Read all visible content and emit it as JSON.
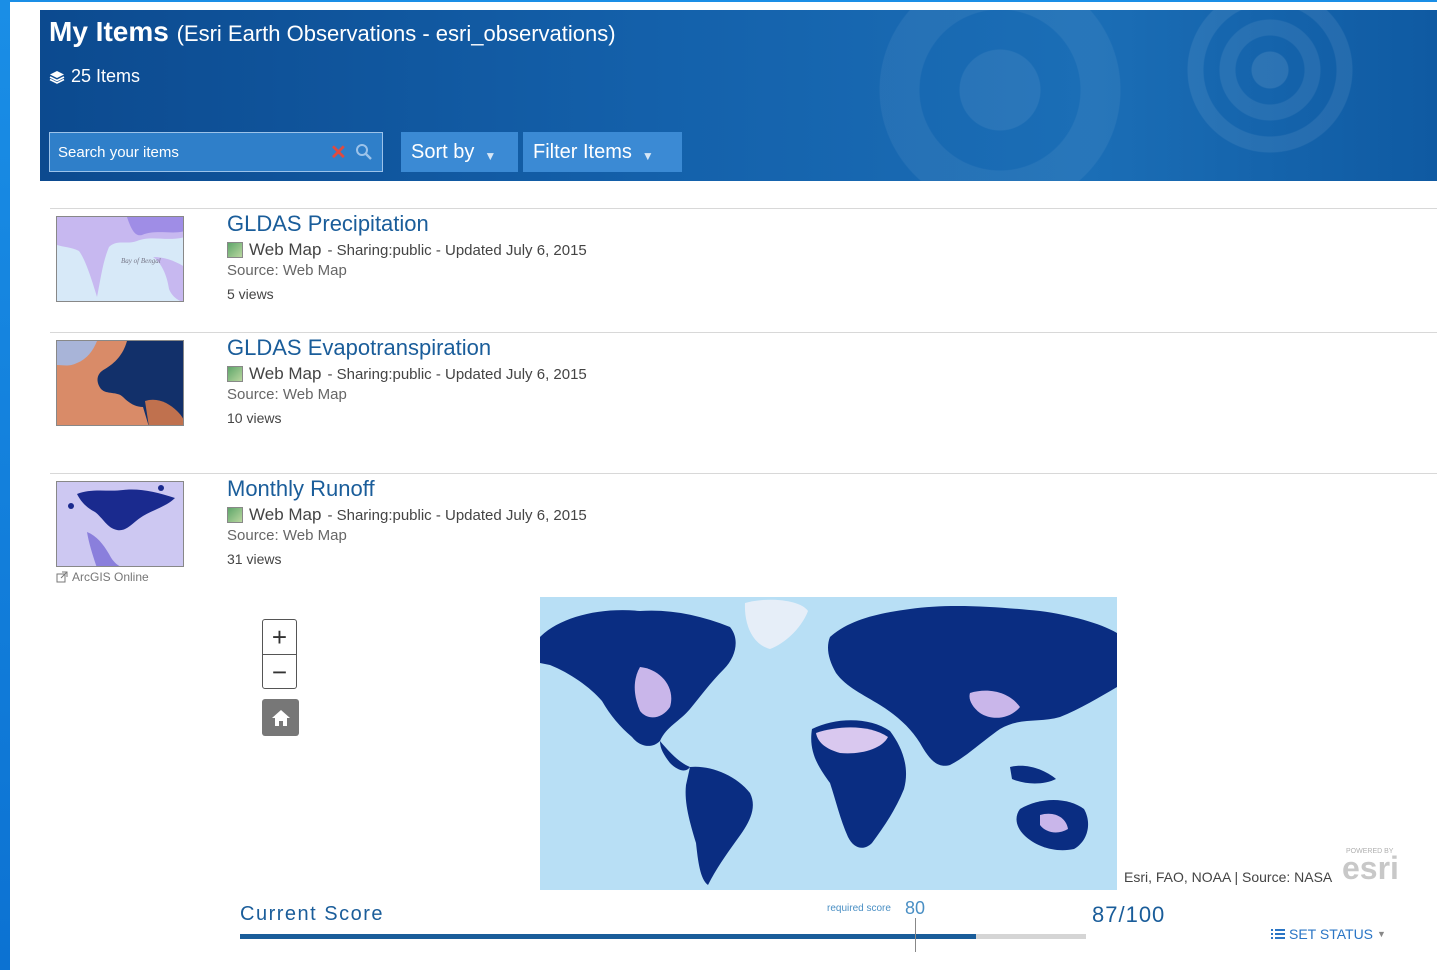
{
  "header": {
    "title": "My Items",
    "subtitle": "(Esri Earth Observations - esri_observations)",
    "item_count": "25 Items",
    "search": {
      "placeholder": "Search your items"
    },
    "sort_label": "Sort by",
    "filter_label": "Filter Items"
  },
  "items": [
    {
      "title": "GLDAS Precipitation",
      "type": "Web Map",
      "meta": "- Sharing:public - Updated July 6, 2015",
      "source": "Source: Web Map",
      "views": "5 views"
    },
    {
      "title": "GLDAS Evapotranspiration",
      "type": "Web Map",
      "meta": "- Sharing:public - Updated July 6, 2015",
      "source": "Source: Web Map",
      "views": "10 views"
    },
    {
      "title": "Monthly Runoff",
      "type": "Web Map",
      "meta": "- Sharing:public - Updated July 6, 2015",
      "source": "Source: Web Map",
      "views": "31 views"
    }
  ],
  "thumb_labels": {
    "bay": "Bay of Bengal"
  },
  "arcgis_link": "ArcGIS Online",
  "map": {
    "attribution": "Esri, FAO, NOAA | Source: NASA",
    "logo_small": "POWERED BY",
    "logo_text": "esri"
  },
  "score": {
    "label": "Current Score",
    "required_label": "required score",
    "required_value": "80",
    "value_text": "87/100",
    "fraction": 0.87,
    "required_fraction": 0.8,
    "set_status": "SET STATUS"
  },
  "colors": {
    "link_blue": "#1a5d9a",
    "header_blue": "#1461ab",
    "land_dark": "#0a2d82",
    "ocean": "#b8dff5"
  }
}
